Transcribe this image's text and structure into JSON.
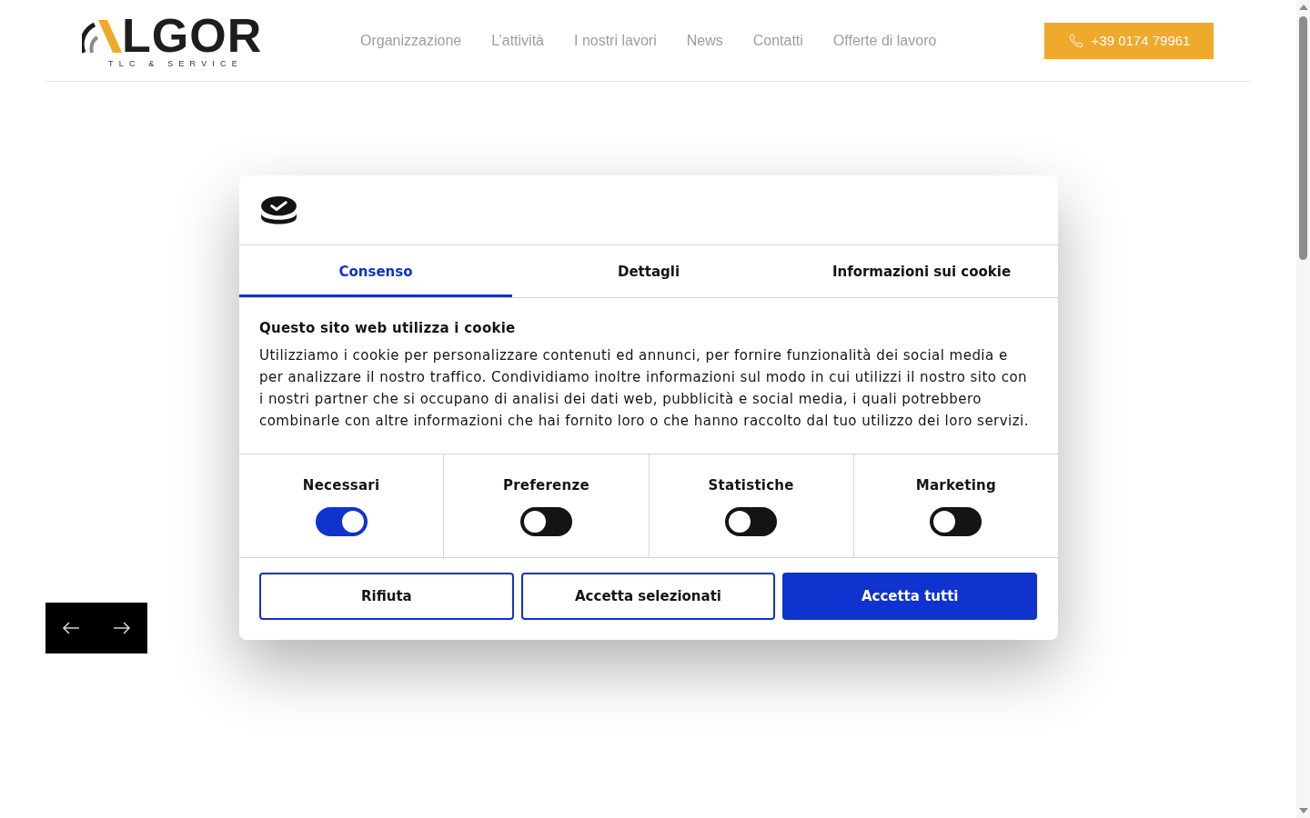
{
  "header": {
    "logo": {
      "wordmark": "LGOR",
      "tagline": "TLC & SERVICE"
    },
    "nav": [
      "Organizzazione",
      "L’attività",
      "I nostri lavori",
      "News",
      "Contatti",
      "Offerte di lavoro"
    ],
    "phone_button": {
      "label": "+39 0174 79961"
    }
  },
  "cookie_dialog": {
    "tabs": [
      {
        "label": "Consenso",
        "selected": true
      },
      {
        "label": "Dettagli",
        "selected": false
      },
      {
        "label": "Informazioni sui cookie",
        "selected": false
      }
    ],
    "heading": "Questo sito web utilizza i cookie",
    "body": "Utilizziamo i cookie per personalizzare contenuti ed annunci, per fornire funzionalità dei social media e per analizzare il nostro traffico. Condividiamo inoltre informazioni sul modo in cui utilizzi il nostro sito con i nostri partner che si occupano di analisi dei dati web, pubblicità e social media, i quali potrebbero combinarle con altre informazioni che hai fornito loro o che hanno raccolto dal tuo utilizzo dei loro servizi.",
    "categories": [
      {
        "label": "Necessari",
        "on": true
      },
      {
        "label": "Preferenze",
        "on": false
      },
      {
        "label": "Statistiche",
        "on": false
      },
      {
        "label": "Marketing",
        "on": false
      }
    ],
    "buttons": [
      {
        "label": "Rifiuta",
        "kind": "outline"
      },
      {
        "label": "Accetta selezionati",
        "kind": "outline"
      },
      {
        "label": "Accetta tutti",
        "kind": "primary"
      }
    ]
  }
}
